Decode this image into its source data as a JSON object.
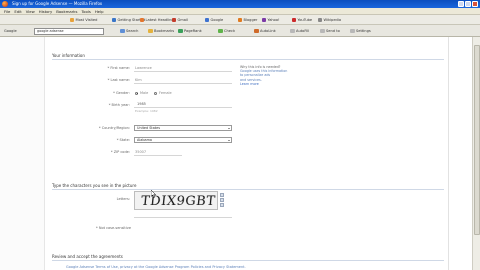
{
  "browser": {
    "title": "Sign up for Google Adsense — Mozilla Firefox",
    "menu": [
      "File",
      "Edit",
      "View",
      "History",
      "Bookmarks",
      "Tools",
      "Help"
    ],
    "bookmarks": [
      {
        "label": "Most Visited",
        "color": "#e8a23a"
      },
      {
        "label": "Getting Started",
        "color": "#3a76c8"
      },
      {
        "label": "Latest Headlines",
        "color": "#e3762e"
      },
      {
        "label": "Gmail",
        "color": "#c43c2c"
      },
      {
        "label": "Google",
        "color": "#3d72d0"
      },
      {
        "label": "Blogger",
        "color": "#e07a1f"
      },
      {
        "label": "Yahoo!",
        "color": "#7c3aa6"
      },
      {
        "label": "YouTube",
        "color": "#cc2a2a"
      },
      {
        "label": "Wikipedia",
        "color": "#888888"
      }
    ],
    "toolbar": {
      "label": "Google",
      "search_value": "google adsense",
      "buttons": [
        {
          "label": "Search",
          "color": "#5f8fd6"
        },
        {
          "label": "Bookmarks",
          "color": "#e4b23c"
        },
        {
          "label": "PageRank",
          "color": "#3aa05a"
        },
        {
          "label": "Check",
          "color": "#5fb34a"
        },
        {
          "label": "AutoLink",
          "color": "#cf6a2a"
        },
        {
          "label": "AutoFill",
          "color": "#b8b8b8"
        },
        {
          "label": "Send to",
          "color": "#b8b8b8"
        },
        {
          "label": "Settings",
          "color": "#b8b8b8"
        }
      ]
    }
  },
  "form": {
    "contact_section": "Your information",
    "first_name_label": "* First name:",
    "first_name_value": "Lawrence",
    "last_name_label": "* Last name:",
    "last_name_value": "Kim",
    "gender_label": "* Gender:",
    "gender_male": "Male",
    "gender_female": "Female",
    "birth_year_label": "* Birth year:",
    "birth_year_value": "1985",
    "birth_year_hint": "Example: 1982",
    "country_label": "* Country/Region:",
    "country_value": "United States",
    "state_label": "* State:",
    "state_value": "Alabama",
    "zip_label": "* ZIP code:",
    "zip_value": "35007",
    "side_note": [
      "Why this info is needed?",
      "Google uses this information",
      "to personalize ads",
      "and services.",
      "Learn more"
    ],
    "verify_section": "Type the characters you see in the picture",
    "captcha_label": "Letters:",
    "captcha_text": "TDIX9GBT",
    "captcha_hint": "* Not case-sensitive",
    "terms_section": "Review and accept the agreements",
    "terms_text": "Google Adsense Terms of Use, privacy at the Google Adsense Program Policies and Privacy Statement."
  }
}
